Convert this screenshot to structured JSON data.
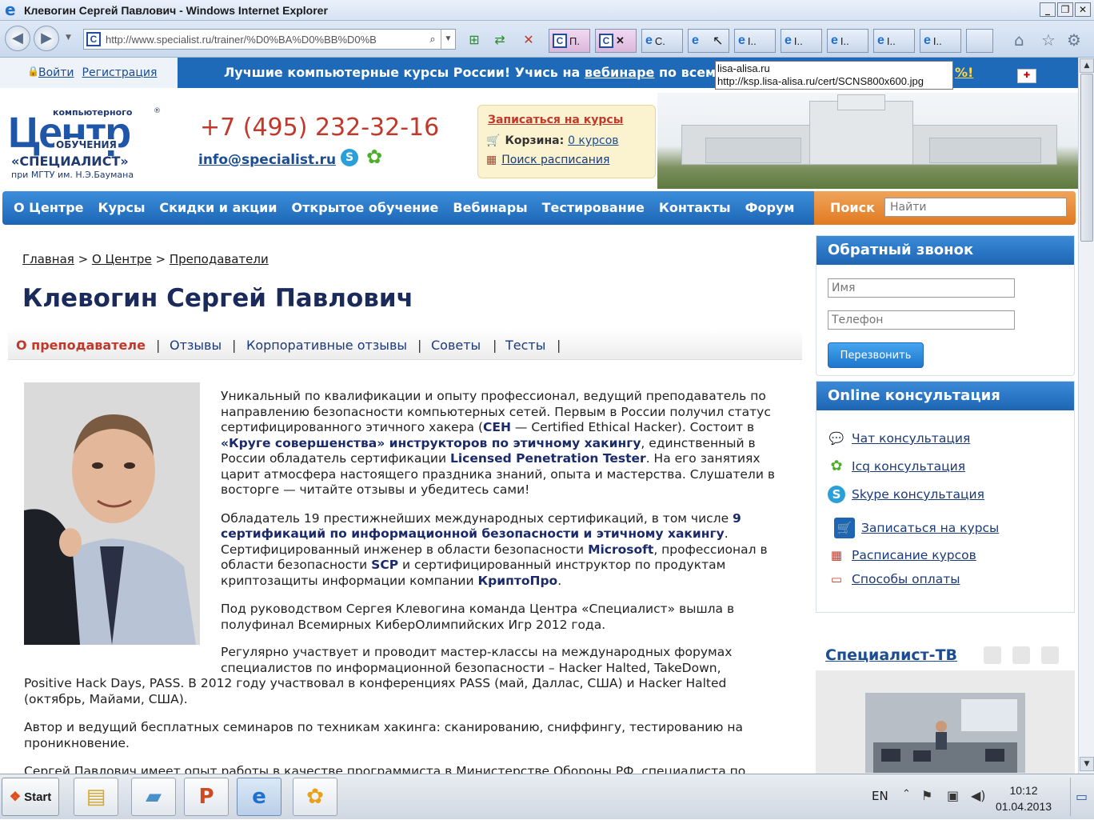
{
  "window": {
    "title": "Клевогин Сергей Павлович - Windows Internet Explorer",
    "controls": [
      "_",
      "❐",
      "✕"
    ]
  },
  "browser": {
    "url": "http://www.specialist.ru/trainer/%D0%BA%D0%BB%D0%B",
    "tabs": [
      {
        "label": "П.",
        "icon": "c-site-icon"
      },
      {
        "label": "",
        "icon": "c-site-icon"
      },
      {
        "label": "С.",
        "icon": "ie-icon"
      },
      {
        "label": "",
        "icon": "ie-icon"
      },
      {
        "label": "I..",
        "icon": "ie-icon"
      },
      {
        "label": "I..",
        "icon": "ie-icon"
      },
      {
        "label": "I..",
        "icon": "ie-icon"
      },
      {
        "label": "I..",
        "icon": "ie-icon"
      },
      {
        "label": "I..",
        "icon": "ie-icon"
      }
    ],
    "tooltip_line1": "lisa-alisa.ru",
    "tooltip_line2": "http://ksp.lisa-alisa.ru/cert/SCNS800x600.jpg"
  },
  "topstrip": {
    "login": "Войти",
    "register": "Регистрация",
    "promo_prefix": "Лучшие компьютерные курсы России! Учись на ",
    "promo_link": "вебинаре",
    "promo_suffix": " по всем",
    "promo_tail": "%!",
    "accent": "#1e6ab8"
  },
  "header": {
    "logo_small": "компьютерного",
    "logo_big": "Центр",
    "logo_obuch": "ОБУЧЕНИЯ",
    "logo_spec": "«СПЕЦИАЛИСТ»",
    "logo_mgtu": "при МГТУ им. Н.Э.Баумана",
    "logo_reg": "®",
    "phone": "+7 (495) 232-32-16",
    "email": "info@specialist.ru",
    "signup": "Записаться на курсы",
    "cart_label": "Корзина:",
    "cart_value": "0 курсов",
    "schedule": "Поиск расписания"
  },
  "nav": {
    "items": [
      "О Центре",
      "Курсы",
      "Скидки и акции",
      "Открытое обучение",
      "Вебинары",
      "Тестирование",
      "Контакты",
      "Форум"
    ],
    "search_label": "Поиск",
    "search_placeholder": "Найти"
  },
  "breadcrumb": {
    "items": [
      "Главная",
      "О Центре",
      "Преподаватели"
    ],
    "sep": ">"
  },
  "page_title": "Клевогин Сергей Павлович",
  "tabs": {
    "items": [
      "О преподавателе",
      "Отзывы",
      "Корпоративные отзывы",
      "Советы",
      "Тесты"
    ]
  },
  "bio": {
    "p1": [
      {
        "t": "Уникальный по квалификации и опыту профессионал, ведущий преподаватель по направлению безопасности компьютерных сетей. Первым в России получил статус сертифицированного этичного хакера (",
        "b": false
      },
      {
        "t": "CEH",
        "b": true
      },
      {
        "t": " — Certified Ethical Hacker). Состоит в ",
        "b": false
      },
      {
        "t": "«Круге совершенства» инструкторов по этичному хакингу",
        "b": true
      },
      {
        "t": ", единственный в России обладатель сертификации ",
        "b": false
      },
      {
        "t": "Licensed Penetration Tester",
        "b": true
      },
      {
        "t": ". На его занятиях царит атмосфера настоящего праздника знаний, опыта и мастерства. Слушатели в восторге — читайте отзывы и убедитесь сами!",
        "b": false
      }
    ],
    "p2": [
      {
        "t": "Обладатель 19 престижнейших международных сертификаций, в том числе ",
        "b": false
      },
      {
        "t": "9 сертификаций по информационной безопасности и этичному хакингу",
        "b": true
      },
      {
        "t": ". Сертифицированный инженер в области безопасности ",
        "b": false
      },
      {
        "t": "Microsoft",
        "b": true
      },
      {
        "t": ", профессионал в области безопасности ",
        "b": false
      },
      {
        "t": "SCP",
        "b": true
      },
      {
        "t": " и сертифицированный инструктор по продуктам криптозащиты информации компании ",
        "b": false
      },
      {
        "t": "КриптоПро",
        "b": true
      },
      {
        "t": ".",
        "b": false
      }
    ],
    "p3": "Под руководством Сергея Клевогина команда Центра «Специалист» вышла в полуфинал Всемирных КиберОлимпийских Игр 2012 года.",
    "p4a": "Регулярно участвует и проводит мастер-классы на международных форумах специалистов по информационной безопасности – Hacker Halted, TakeDown,",
    "p4b": "Positive Hack Days, PASS. В 2012 году участвовал в конференциях PASS (май, Даллас, США) и Hacker Halted (октябрь, Майами, США).",
    "p5": "Автор и ведущий бесплатных семинаров по техникам хакинга: сканированию, сниффингу, тестированию на проникновение.",
    "p6": "Сергей Павлович имеет опыт работы в качестве программиста в Министерстве Обороны РФ, специалиста по"
  },
  "sidebar": {
    "callback_title": "Обратный звонок",
    "name_placeholder": "Имя",
    "phone_placeholder": "Телефон",
    "callback_button": "Перезвонить",
    "online_title": "Online консультация",
    "links": [
      {
        "label": "Чат консультация",
        "icon": "chat-icon"
      },
      {
        "label": "Icq консультация",
        "icon": "icq-icon"
      },
      {
        "label": "Skype консультация",
        "icon": "skype-icon"
      },
      {
        "label": "Записаться на курсы",
        "icon": "cart-icon"
      },
      {
        "label": "Расписание курсов",
        "icon": "calendar-icon"
      },
      {
        "label": "Способы оплаты",
        "icon": "wallet-icon"
      }
    ],
    "tv_title": "Специалист-ТВ"
  },
  "taskbar": {
    "start": "Start",
    "lang": "EN",
    "time": "10:12",
    "date": "01.04.2013"
  }
}
